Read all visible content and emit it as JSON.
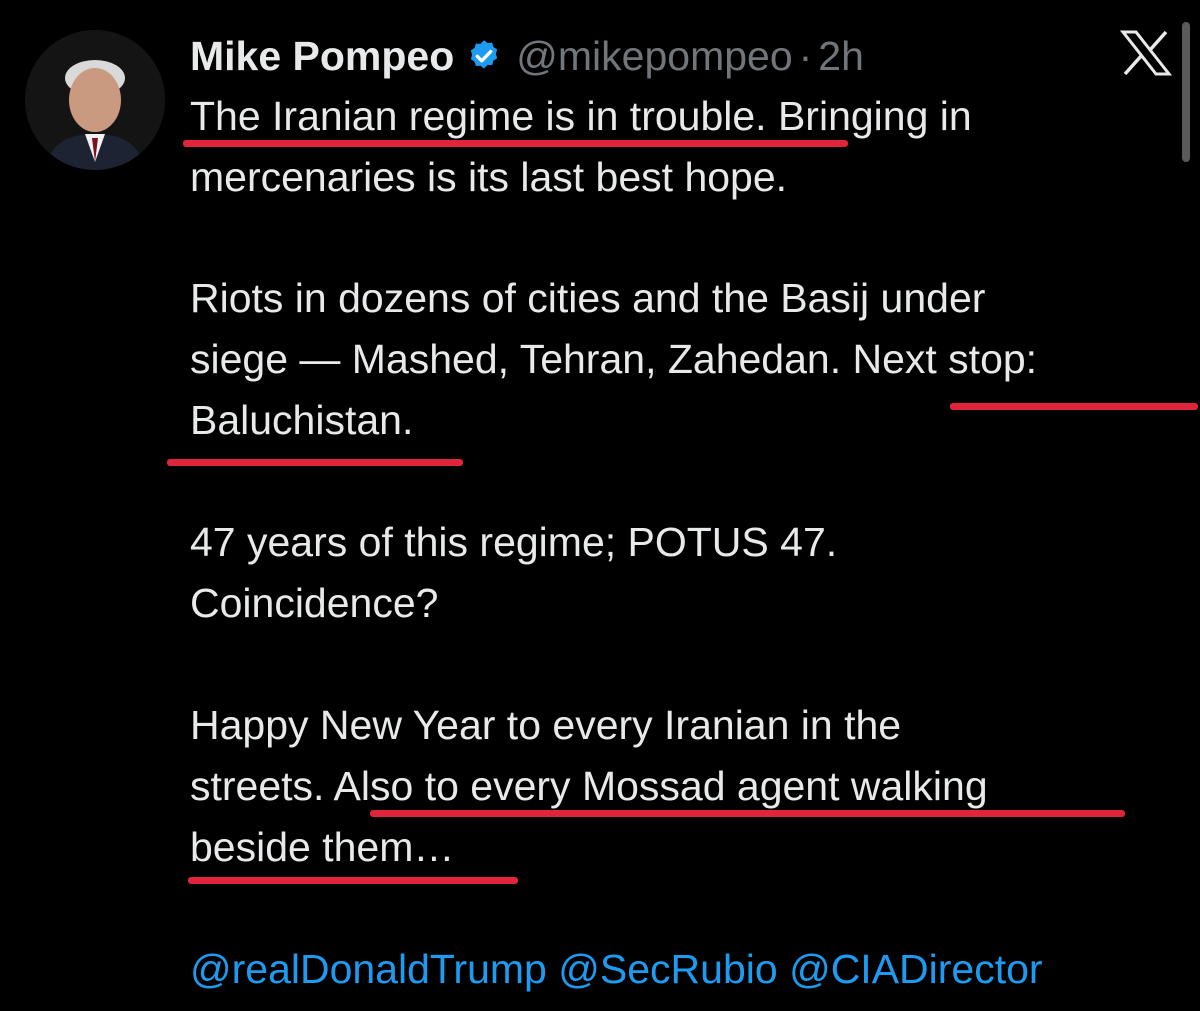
{
  "tweet": {
    "author": {
      "display_name": "Mike Pompeo",
      "verified": true,
      "handle": "@mikepompeo",
      "separator": "·",
      "time_ago": "2h"
    },
    "platform_logo": "X",
    "body_lines": [
      "The Iranian regime is in trouble. Bringing in",
      "mercenaries is its last best hope.",
      "Riots in dozens of cities and the Basij under",
      "siege — Mashed, Tehran, Zahedan.  Next stop:",
      "Baluchistan.",
      "47 years of this regime; POTUS 47.",
      "Coincidence?",
      "Happy New Year to every Iranian in the",
      "streets.  Also to every Mossad agent walking",
      "beside them…"
    ],
    "mentions": [
      "@realDonaldTrump",
      "@SecRubio",
      "@CIADirector"
    ]
  },
  "colors": {
    "background": "#000000",
    "text": "#e7e9ea",
    "muted": "#71767b",
    "link": "#1d9bf0",
    "verified": "#1d9bf0",
    "annotation_underline": "#e0243a"
  },
  "icons": {
    "verified": "verified-badge-icon",
    "logo": "x-logo-icon"
  }
}
